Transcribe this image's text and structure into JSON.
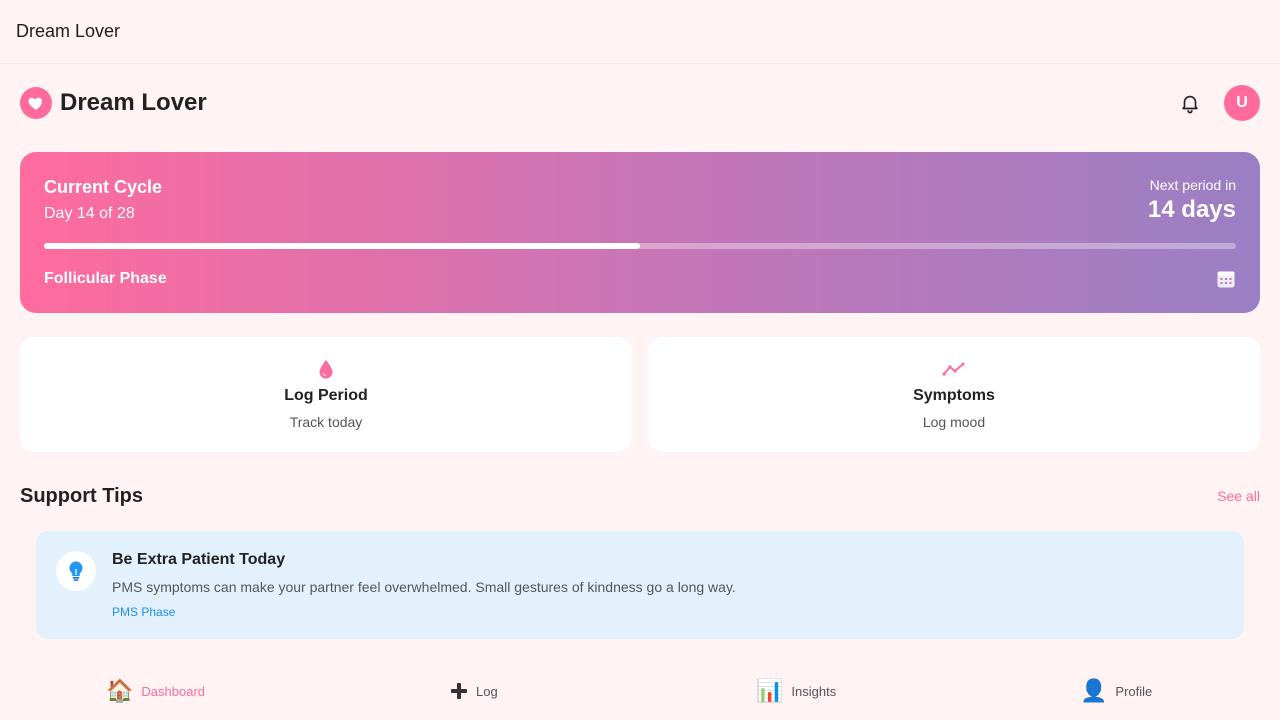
{
  "window": {
    "title": "Dream Lover"
  },
  "header": {
    "brand": "Dream Lover",
    "avatar_initial": "U"
  },
  "cycle": {
    "title": "Current Cycle",
    "day_text": "Day 14 of 28",
    "next_label": "Next period in",
    "next_value": "14 days",
    "progress": 0.5,
    "phase": "Follicular Phase"
  },
  "actions": [
    {
      "title": "Log Period",
      "subtitle": "Track today",
      "icon": "droplet-icon"
    },
    {
      "title": "Symptoms",
      "subtitle": "Log mood",
      "icon": "activity-chart-icon"
    }
  ],
  "tips": {
    "section_title": "Support Tips",
    "see_all": "See all",
    "items": [
      {
        "title": "Be Extra Patient Today",
        "body": "PMS symptoms can make your partner feel overwhelmed. Small gestures of kindness go a long way.",
        "tag": "PMS Phase",
        "icon": "lightbulb-icon"
      }
    ]
  },
  "nav": [
    {
      "label": "Dashboard",
      "icon": "house-icon",
      "emoji": "🏠",
      "active": true
    },
    {
      "label": "Log",
      "icon": "plus-icon",
      "emoji": "➕",
      "active": false
    },
    {
      "label": "Insights",
      "icon": "bar-chart-icon",
      "emoji": "📊",
      "active": false
    },
    {
      "label": "Profile",
      "icon": "user-icon",
      "emoji": "👤",
      "active": false
    }
  ],
  "colors": {
    "accent": "#ff6b9d",
    "gradient_end": "#9a7fc4",
    "tip_bg": "#e3f1fc",
    "tip_tag": "#1f8ee8",
    "page_bg": "#fff3f4"
  }
}
